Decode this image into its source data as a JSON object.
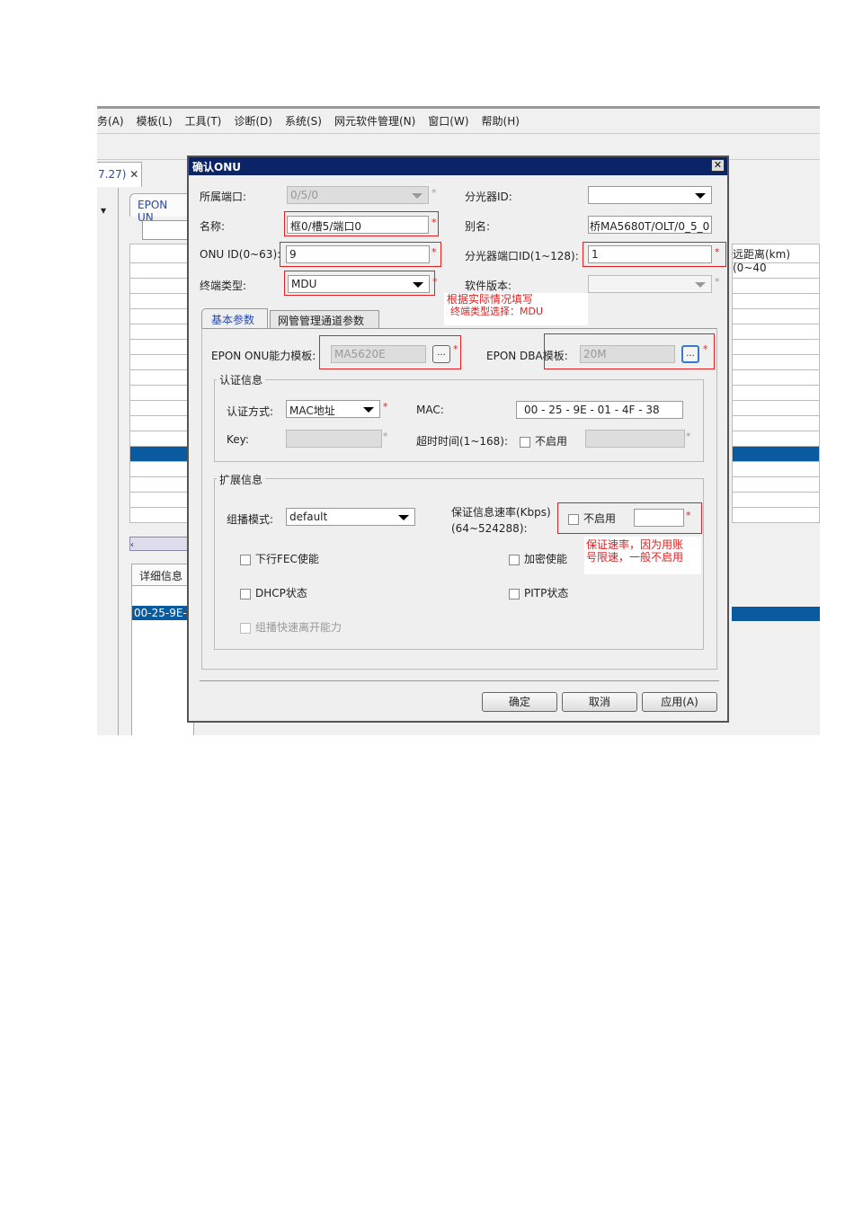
{
  "menu": [
    "务(A)",
    "模板(L)",
    "工具(T)",
    "诊断(D)",
    "系统(S)",
    "网元软件管理(N)",
    "窗口(W)",
    "帮助(H)"
  ],
  "bg": {
    "tab_label": "7.27)",
    "inner_tab": "EPON UN",
    "detail_tab": "详细信息",
    "detail_value": "00-25-9E-",
    "right_header": "远距离(km)(0~40"
  },
  "dialog": {
    "title": "确认ONU",
    "port_label": "所属端口:",
    "port_value": "0/5/0",
    "name_label": "名称:",
    "name_value": "框0/槽5/端口0",
    "onuid_label": "ONU ID(0~63):",
    "onuid_value": "9",
    "type_label": "终端类型:",
    "type_value": "MDU",
    "splitter_label": "分光器ID:",
    "splitter_value": "",
    "alias_label": "别名:",
    "alias_value": "桥MA5680T/OLT/0_5_0",
    "splitter_port_label": "分光器端口ID(1~128):",
    "splitter_port_value": "1",
    "sw_label": "软件版本:",
    "sw_value": "",
    "note1": "根据实际情况填写",
    "note2": "终端类型选择：MDU",
    "tabs": [
      "基本参数",
      "网管管理通道参数"
    ],
    "cap_label": "EPON ONU能力模板:",
    "cap_value": "MA5620E",
    "dba_label": "EPON DBA模板:",
    "dba_value": "20M",
    "dots": "...",
    "auth_group": "认证信息",
    "auth_mode_label": "认证方式:",
    "auth_mode_value": "MAC地址",
    "mac_label": "MAC:",
    "mac_value": "00 - 25 - 9E - 01 - 4F - 38",
    "key_label": "Key:",
    "timeout_label": "超时时间(1~168):",
    "disable": "不启用",
    "ext_group": "扩展信息",
    "mcast_label": "组播模式:",
    "mcast_value": "default",
    "cir_label1": "保证信息速率(Kbps)",
    "cir_label2": "(64~524288):",
    "note3": "保证速率，因为用账",
    "note4": "号限速，一般不启用",
    "fec": "下行FEC使能",
    "encrypt": "加密使能",
    "dhcp": "DHCP状态",
    "pitp": "PITP状态",
    "fast_leave": "组播快速离开能力",
    "ok": "确定",
    "cancel": "取消",
    "apply": "应用(A)"
  }
}
